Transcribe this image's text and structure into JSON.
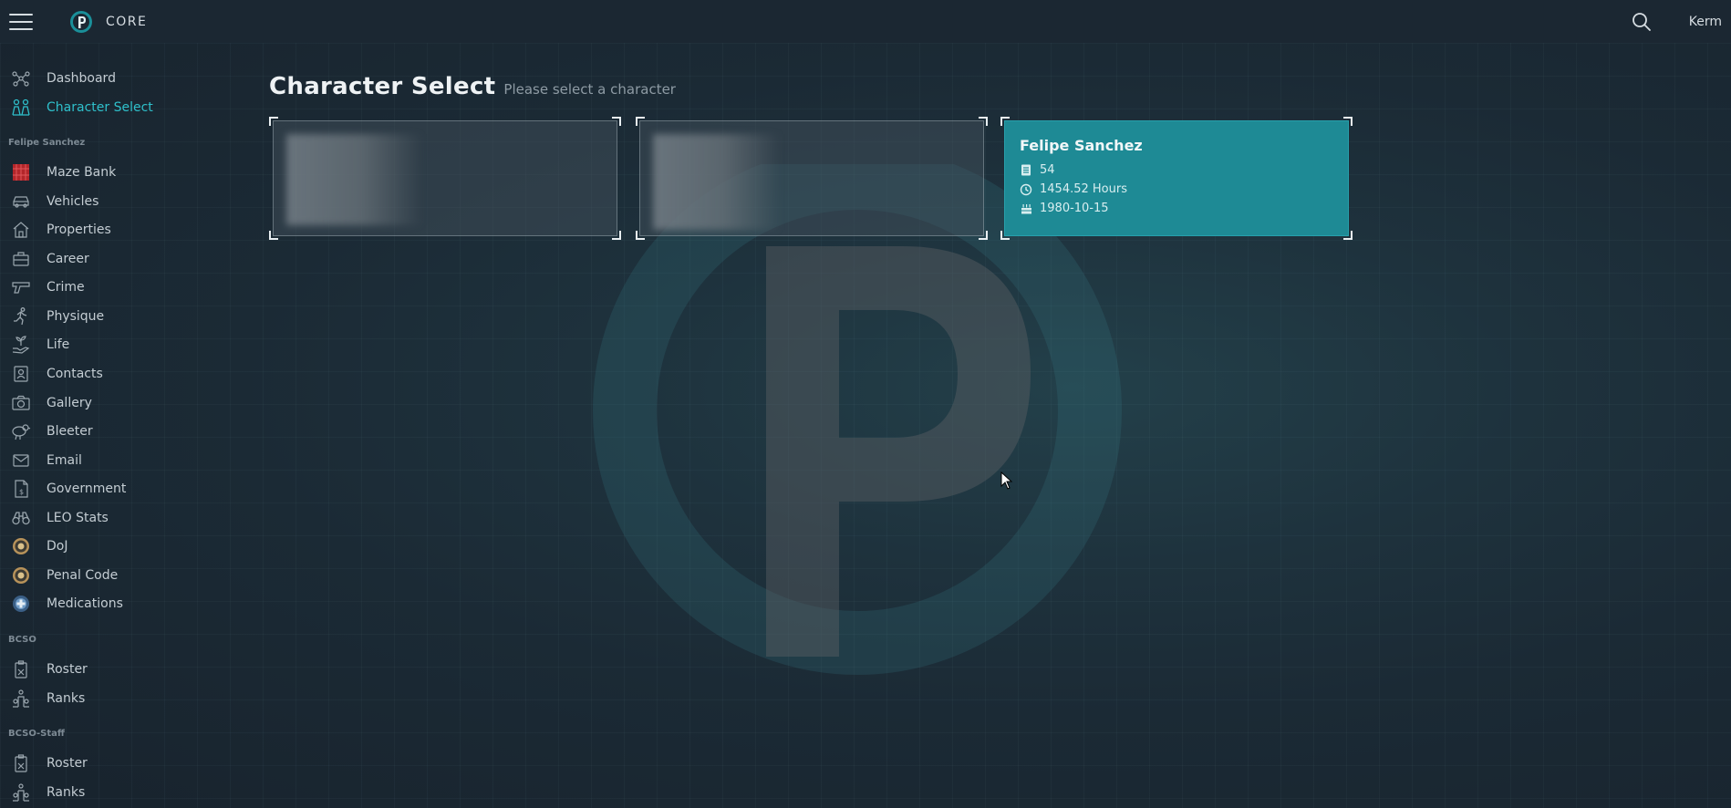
{
  "app": {
    "brand": "CORE",
    "user": "Kerm",
    "accent": "#2fc0cb"
  },
  "sidebar": {
    "top_items": [
      {
        "label": "Dashboard",
        "icon": "network-icon"
      },
      {
        "label": "Character Select",
        "icon": "people-icon",
        "active": true
      }
    ],
    "sections": [
      {
        "label": "Felipe Sanchez",
        "items": [
          {
            "label": "Maze Bank",
            "icon": "maze-bank-icon"
          },
          {
            "label": "Vehicles",
            "icon": "car-icon"
          },
          {
            "label": "Properties",
            "icon": "house-icon"
          },
          {
            "label": "Career",
            "icon": "briefcase-icon"
          },
          {
            "label": "Crime",
            "icon": "pistol-icon"
          },
          {
            "label": "Physique",
            "icon": "running-icon"
          },
          {
            "label": "Life",
            "icon": "hand-plant-icon"
          },
          {
            "label": "Contacts",
            "icon": "contact-card-icon"
          },
          {
            "label": "Gallery",
            "icon": "camera-icon"
          },
          {
            "label": "Bleeter",
            "icon": "bird-icon"
          },
          {
            "label": "Email",
            "icon": "envelope-icon"
          },
          {
            "label": "Government",
            "icon": "document-dollar-icon"
          },
          {
            "label": "LEO Stats",
            "icon": "binoculars-icon"
          },
          {
            "label": "DoJ",
            "icon": "doj-seal-icon"
          },
          {
            "label": "Penal Code",
            "icon": "doj-seal-icon"
          },
          {
            "label": "Medications",
            "icon": "medical-seal-icon"
          }
        ]
      },
      {
        "label": "BCSO",
        "items": [
          {
            "label": "Roster",
            "icon": "badge-icon"
          },
          {
            "label": "Ranks",
            "icon": "hierarchy-icon"
          }
        ]
      },
      {
        "label": "BCSO-Staff",
        "items": [
          {
            "label": "Roster",
            "icon": "badge-icon"
          },
          {
            "label": "Ranks",
            "icon": "hierarchy-icon"
          }
        ]
      }
    ]
  },
  "main": {
    "title": "Character Select",
    "subtitle": "Please select a character",
    "cards": [
      {
        "redacted": true
      },
      {
        "redacted": true
      },
      {
        "name": "Felipe Sanchez",
        "stats": [
          {
            "icon": "id-card-icon",
            "value": "54"
          },
          {
            "icon": "clock-icon",
            "value": "1454.52 Hours"
          },
          {
            "icon": "cake-icon",
            "value": "1980-10-15"
          }
        ],
        "selected": true
      }
    ]
  }
}
